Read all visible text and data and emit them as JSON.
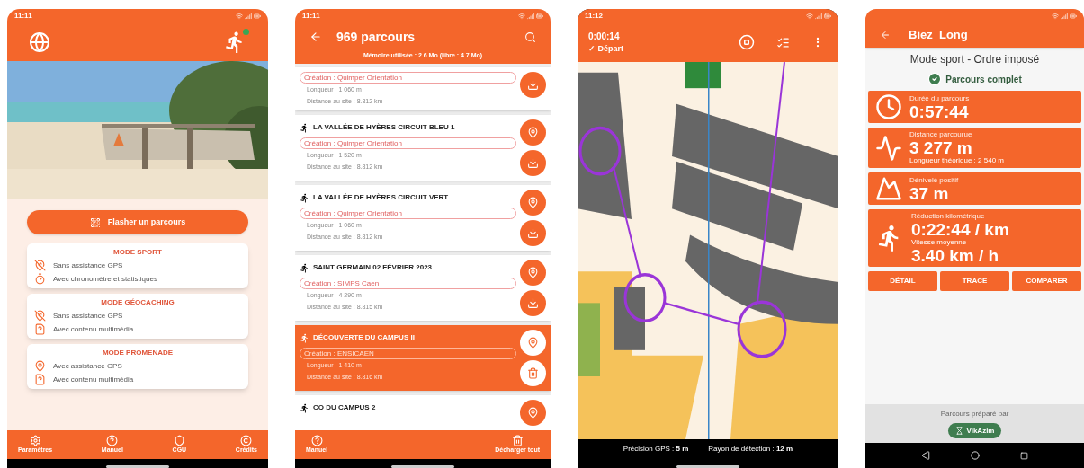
{
  "home": {
    "status_time": "11:11",
    "flash_button": "Flasher un parcours",
    "modes": [
      {
        "title": "MODE SPORT",
        "features": [
          {
            "kind": "no-gps",
            "text": "Sans assistance GPS"
          },
          {
            "kind": "timer",
            "text": "Avec chronomètre et statistiques"
          }
        ]
      },
      {
        "title": "MODE GÉOCACHING",
        "features": [
          {
            "kind": "no-gps",
            "text": "Sans assistance GPS"
          },
          {
            "kind": "media",
            "text": "Avec contenu multimédia"
          }
        ]
      },
      {
        "title": "MODE PROMENADE",
        "features": [
          {
            "kind": "gps",
            "text": "Avec assistance GPS"
          },
          {
            "kind": "media",
            "text": "Avec contenu multimédia"
          }
        ]
      }
    ],
    "nav": [
      {
        "kind": "settings",
        "label": "Paramètres"
      },
      {
        "kind": "help",
        "label": "Manuel"
      },
      {
        "kind": "shield",
        "label": "CGU"
      },
      {
        "kind": "copyright",
        "label": "Crédits"
      }
    ]
  },
  "list": {
    "status_time": "11:11",
    "title": "969 parcours",
    "memory": "Mémoire utilisée : 2.6 Mo (libre : 4.7 Mo)",
    "courses": [
      {
        "creator": "Création : Quimper Orientation",
        "length": "Longueur : 1 060 m",
        "distance": "Distance au site : 8.812 km",
        "selected": false,
        "actions": [
          {
            "kind": "download"
          }
        ]
      },
      {
        "name": "LA VALLÉE DE HYÈRES CIRCUIT BLEU 1",
        "creator": "Création : Quimper Orientation",
        "length": "Longueur : 1 520 m",
        "distance": "Distance au site : 8.812 km",
        "selected": false,
        "actions": [
          {
            "kind": "locate"
          },
          {
            "kind": "download"
          }
        ]
      },
      {
        "name": "LA VALLÉE DE HYÈRES CIRCUIT VERT",
        "creator": "Création : Quimper Orientation",
        "length": "Longueur : 1 060 m",
        "distance": "Distance au site : 8.812 km",
        "selected": false,
        "actions": [
          {
            "kind": "locate"
          },
          {
            "kind": "download"
          }
        ]
      },
      {
        "name": "SAINT GERMAIN 02 FÉVRIER 2023",
        "creator": "Création : SIMPS Caen",
        "length": "Longueur : 4 290 m",
        "distance": "Distance au site : 8.815 km",
        "selected": false,
        "actions": [
          {
            "kind": "locate"
          },
          {
            "kind": "download"
          }
        ]
      },
      {
        "name": "DÉCOUVERTE DU CAMPUS II",
        "creator": "Création : ENSICAEN",
        "length": "Longueur : 1 410 m",
        "distance": "Distance au site : 8.816 km",
        "selected": true,
        "actions": [
          {
            "kind": "locate"
          },
          {
            "kind": "delete"
          }
        ]
      },
      {
        "name": "CO DU CAMPUS 2",
        "selected": false,
        "actions": [
          {
            "kind": "locate"
          }
        ]
      }
    ],
    "nav": [
      {
        "kind": "help",
        "label": "Manuel"
      },
      {
        "kind": "delete",
        "label": "Décharger tout"
      }
    ]
  },
  "map": {
    "status_time": "11:12",
    "timer": "0:00:14",
    "start": "✓ Départ",
    "gps_precision": "Précision GPS : **5 m**",
    "detection_radius": "Rayon de détection : **12 m**"
  },
  "result": {
    "title": "Biez_Long",
    "mode": "Mode sport - Ordre imposé",
    "status": "Parcours complet",
    "stats": [
      {
        "kind": "clock",
        "label": "Durée du parcours",
        "value": "0:57:44"
      },
      {
        "kind": "distance",
        "label": "Distance parcourue",
        "value": "3 277 m",
        "note": "Longueur théorique : 2 540 m"
      },
      {
        "kind": "elevation",
        "label": "Dénivelé positif",
        "value": "37 m"
      },
      {
        "kind": "pace",
        "label": "Réduction kilométrique",
        "value": "0:22:44 / km",
        "label2": "Vitesse moyenne",
        "value2": "3.40 km / h"
      }
    ],
    "buttons": [
      "DÉTAIL",
      "TRACE",
      "COMPARER"
    ],
    "prepared_by": "Parcours préparé par",
    "author": "VikAzim"
  }
}
